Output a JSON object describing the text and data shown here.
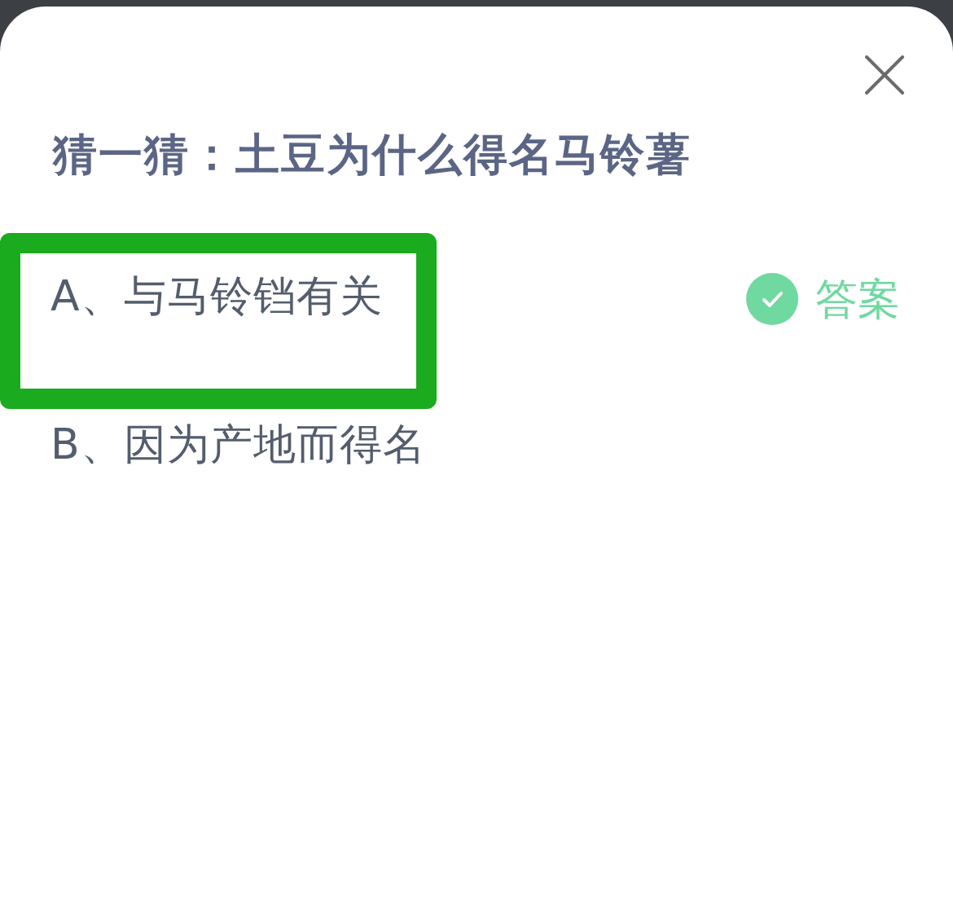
{
  "title": "猜一猜：土豆为什么得名马铃薯",
  "options": [
    {
      "label": "A、与马铃铛有关",
      "highlighted": true,
      "answer_label": "答案"
    },
    {
      "label": "B、因为产地而得名",
      "highlighted": false
    }
  ]
}
